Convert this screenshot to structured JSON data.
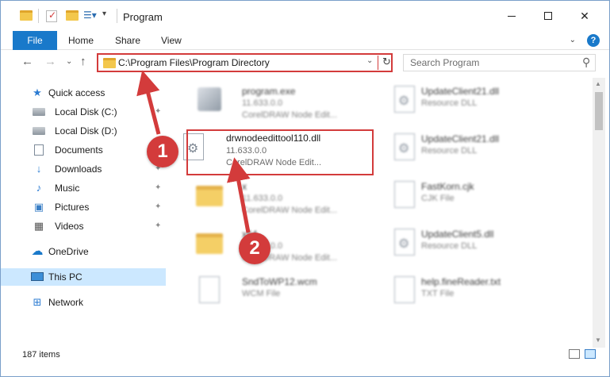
{
  "window": {
    "title": "Program",
    "controls": {
      "minimize": "minimize-icon",
      "maximize": "maximize-icon",
      "close": "✕"
    }
  },
  "ribbon": {
    "file": "File",
    "tabs": [
      "Home",
      "Share",
      "View"
    ]
  },
  "address": {
    "path": "C:\\Program Files\\Program Directory"
  },
  "search": {
    "placeholder": "Search Program"
  },
  "sidebar": {
    "items": [
      {
        "label": "Quick access",
        "icon": "star-icon"
      },
      {
        "label": "Local Disk (C:)",
        "icon": "disk-icon"
      },
      {
        "label": "Local Disk (D:)",
        "icon": "disk-icon"
      },
      {
        "label": "Documents",
        "icon": "document-icon"
      },
      {
        "label": "Downloads",
        "icon": "download-icon"
      },
      {
        "label": "Music",
        "icon": "music-icon"
      },
      {
        "label": "Pictures",
        "icon": "pictures-icon"
      },
      {
        "label": "Videos",
        "icon": "videos-icon"
      },
      {
        "label": "OneDrive",
        "icon": "cloud-icon"
      },
      {
        "label": "This PC",
        "icon": "computer-icon"
      },
      {
        "label": "Network",
        "icon": "network-icon"
      }
    ]
  },
  "files": {
    "left": [
      {
        "name": "program.exe",
        "line2": "11.633.0.0",
        "line3": "CorelDRAW Node Edit...",
        "icon": "exe-icon"
      },
      {
        "name": "drwnodeedittool110.dll",
        "line2": "11.633.0.0",
        "line3": "CorelDRAW Node Edit...",
        "icon": "dll-icon"
      },
      {
        "name": "x",
        "line2": "11.633.0.0",
        "line3": "CorelDRAW Node Edit...",
        "icon": "folder-icon"
      },
      {
        "name": "x64",
        "line2": "11.633.0.0",
        "line3": "CorelDRAW Node Edit...",
        "icon": "folder-icon"
      },
      {
        "name": "SndToWP12.wcm",
        "line2": "WCM File",
        "line3": "",
        "icon": "file-icon"
      }
    ],
    "right": [
      {
        "name": "UpdateClient21.dll",
        "line2": "Resource DLL",
        "icon": "dll-icon"
      },
      {
        "name": "UpdateClient21.dll",
        "line2": "Resource DLL",
        "icon": "dll-icon"
      },
      {
        "name": "FastKorn.cjk",
        "line2": "CJK File",
        "icon": "file-icon"
      },
      {
        "name": "UpdateClient5.dll",
        "line2": "Resource DLL",
        "icon": "dll-icon"
      },
      {
        "name": "help.fineReader.txt",
        "line2": "TXT File",
        "icon": "file-icon"
      }
    ]
  },
  "status": {
    "count": "187 items"
  },
  "callouts": [
    "1",
    "2"
  ],
  "colors": {
    "accent": "#1979ca",
    "highlight": "#d33b3b",
    "selected": "#cce8ff"
  }
}
